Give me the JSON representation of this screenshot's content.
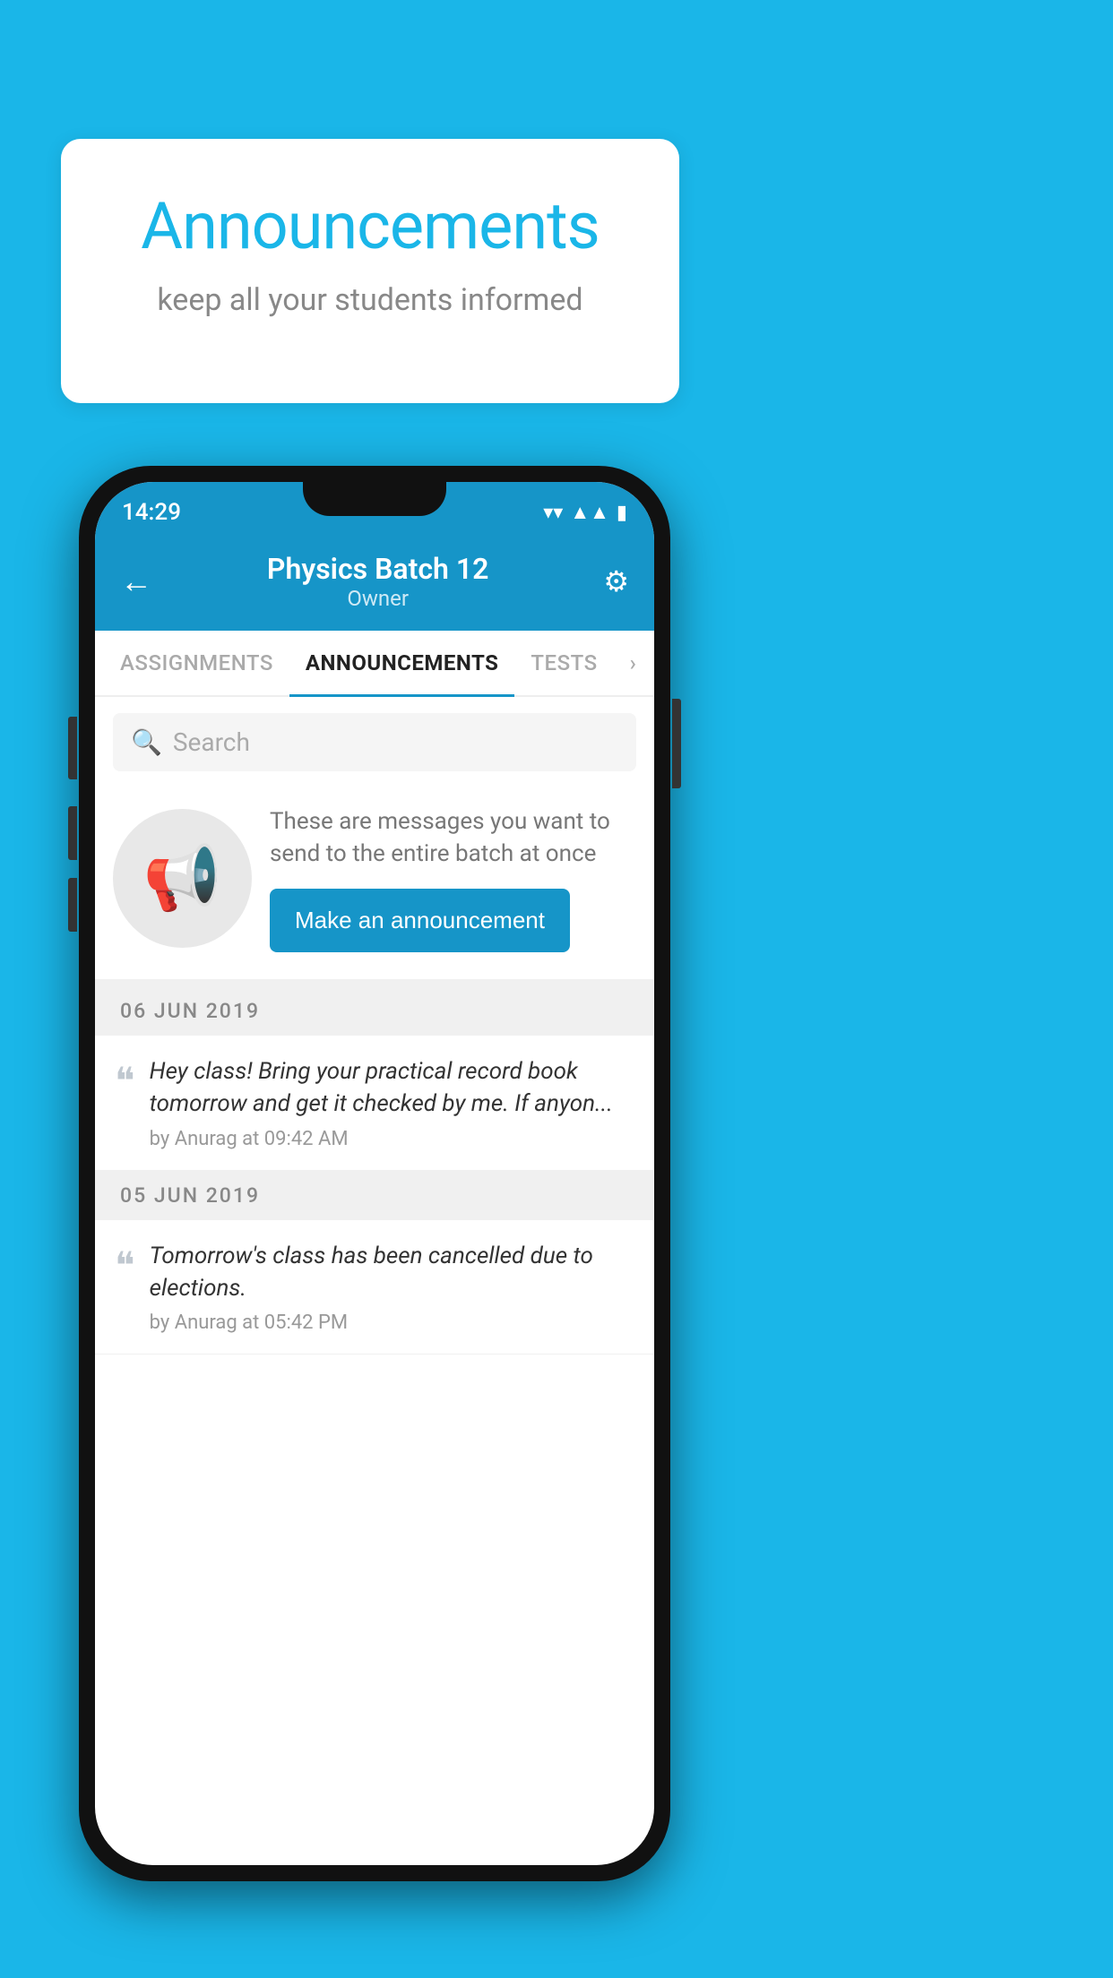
{
  "background_color": "#1ab6e8",
  "bubble": {
    "title": "Announcements",
    "subtitle": "keep all your students informed"
  },
  "phone": {
    "status_bar": {
      "time": "14:29"
    },
    "header": {
      "title": "Physics Batch 12",
      "subtitle": "Owner",
      "back_label": "←",
      "gear_label": "⚙"
    },
    "tabs": [
      {
        "label": "ASSIGNMENTS",
        "active": false
      },
      {
        "label": "ANNOUNCEMENTS",
        "active": true
      },
      {
        "label": "TESTS",
        "active": false
      },
      {
        "label": "›",
        "active": false
      }
    ],
    "search": {
      "placeholder": "Search"
    },
    "promo": {
      "description": "These are messages you want to send to the entire batch at once",
      "button_label": "Make an announcement"
    },
    "announcements": [
      {
        "date": "06  JUN  2019",
        "message": "Hey class! Bring your practical record book tomorrow and get it checked by me. If anyon...",
        "meta": "by Anurag at 09:42 AM"
      },
      {
        "date": "05  JUN  2019",
        "message": "Tomorrow's class has been cancelled due to elections.",
        "meta": "by Anurag at 05:42 PM"
      }
    ]
  }
}
